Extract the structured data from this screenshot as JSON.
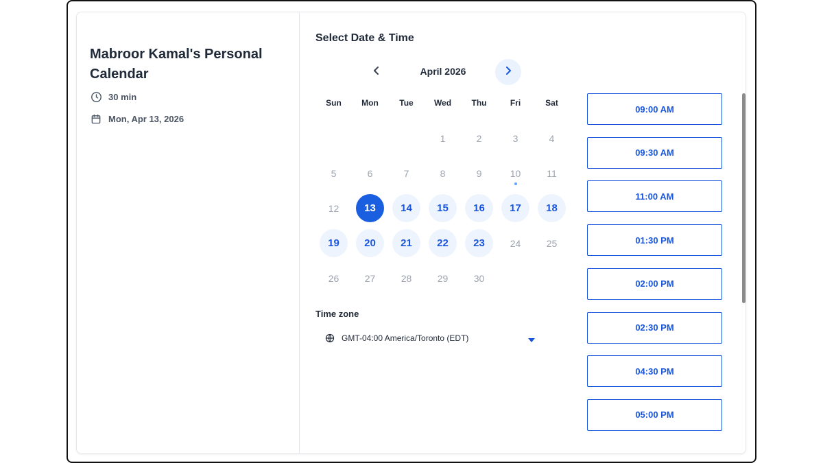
{
  "event": {
    "title": "Mabroor Kamal's Personal Calendar",
    "duration": "30 min",
    "date": "Mon, Apr 13, 2026"
  },
  "scheduler": {
    "heading": "Select Date & Time",
    "month_label": "April 2026",
    "weekdays": [
      "Sun",
      "Mon",
      "Tue",
      "Wed",
      "Thu",
      "Fri",
      "Sat"
    ],
    "weeks": [
      [
        {
          "day": ""
        },
        {
          "day": ""
        },
        {
          "day": ""
        },
        {
          "day": "1"
        },
        {
          "day": "2"
        },
        {
          "day": "3"
        },
        {
          "day": "4"
        }
      ],
      [
        {
          "day": "5"
        },
        {
          "day": "6"
        },
        {
          "day": "7"
        },
        {
          "day": "8"
        },
        {
          "day": "9"
        },
        {
          "day": "10",
          "today": true
        },
        {
          "day": "11"
        }
      ],
      [
        {
          "day": "12"
        },
        {
          "day": "13",
          "available": true,
          "selected": true
        },
        {
          "day": "14",
          "available": true
        },
        {
          "day": "15",
          "available": true
        },
        {
          "day": "16",
          "available": true
        },
        {
          "day": "17",
          "available": true
        },
        {
          "day": "18",
          "available": true
        }
      ],
      [
        {
          "day": "19",
          "available": true
        },
        {
          "day": "20",
          "available": true
        },
        {
          "day": "21",
          "available": true
        },
        {
          "day": "22",
          "available": true
        },
        {
          "day": "23",
          "available": true
        },
        {
          "day": "24"
        },
        {
          "day": "25"
        }
      ],
      [
        {
          "day": "26"
        },
        {
          "day": "27"
        },
        {
          "day": "28"
        },
        {
          "day": "29"
        },
        {
          "day": "30"
        },
        {
          "day": ""
        },
        {
          "day": ""
        }
      ]
    ],
    "timezone_label": "Time zone",
    "timezone_value": "GMT-04:00 America/Toronto (EDT)",
    "time_slots": [
      "09:00 AM",
      "09:30 AM",
      "11:00 AM",
      "01:30 PM",
      "02:00 PM",
      "02:30 PM",
      "04:30 PM",
      "05:00 PM"
    ]
  },
  "icons": {
    "duration": "clock-icon",
    "date": "calendar-icon",
    "prev": "chevron-left-icon",
    "next": "chevron-right-icon",
    "timezone": "globe-icon",
    "dropdown": "caret-down-icon"
  },
  "colors": {
    "accent": "#1a56db",
    "selected": "#1a5fe0",
    "available_bg": "#eef4fd",
    "muted_text": "#9ca3af"
  }
}
